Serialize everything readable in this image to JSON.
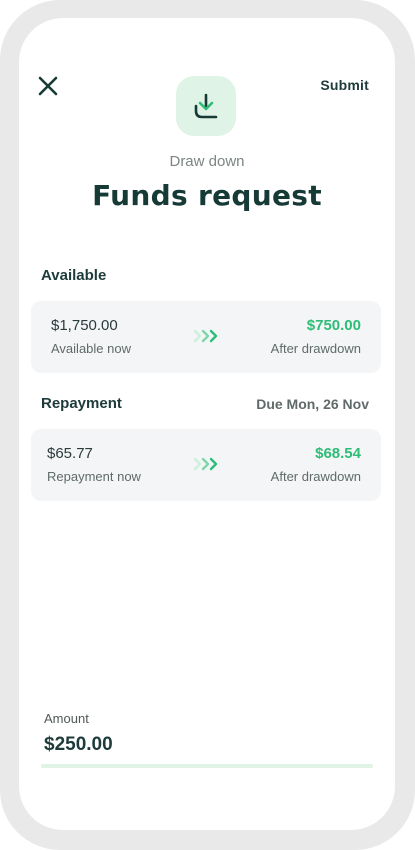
{
  "header": {
    "submit_label": "Submit",
    "subtitle": "Draw down",
    "title": "Funds request"
  },
  "icons": {
    "close": "close-icon",
    "download": "download-icon",
    "arrows": "chevron-right-triple-icon"
  },
  "available": {
    "label": "Available",
    "left_value": "$1,750.00",
    "left_caption": "Available now",
    "right_value": "$750.00",
    "right_caption": "After drawdown"
  },
  "repayment": {
    "label": "Repayment",
    "due": "Due Mon, 26 Nov",
    "left_value": "$65.77",
    "left_caption": "Repayment now",
    "right_value": "$68.54",
    "right_caption": "After drawdown"
  },
  "amount": {
    "label": "Amount",
    "value": "$250.00"
  },
  "colors": {
    "accent": "#2ebc77",
    "heading": "#163a36",
    "icon_bg": "#dff3e6",
    "card_bg": "#f4f5f7"
  }
}
